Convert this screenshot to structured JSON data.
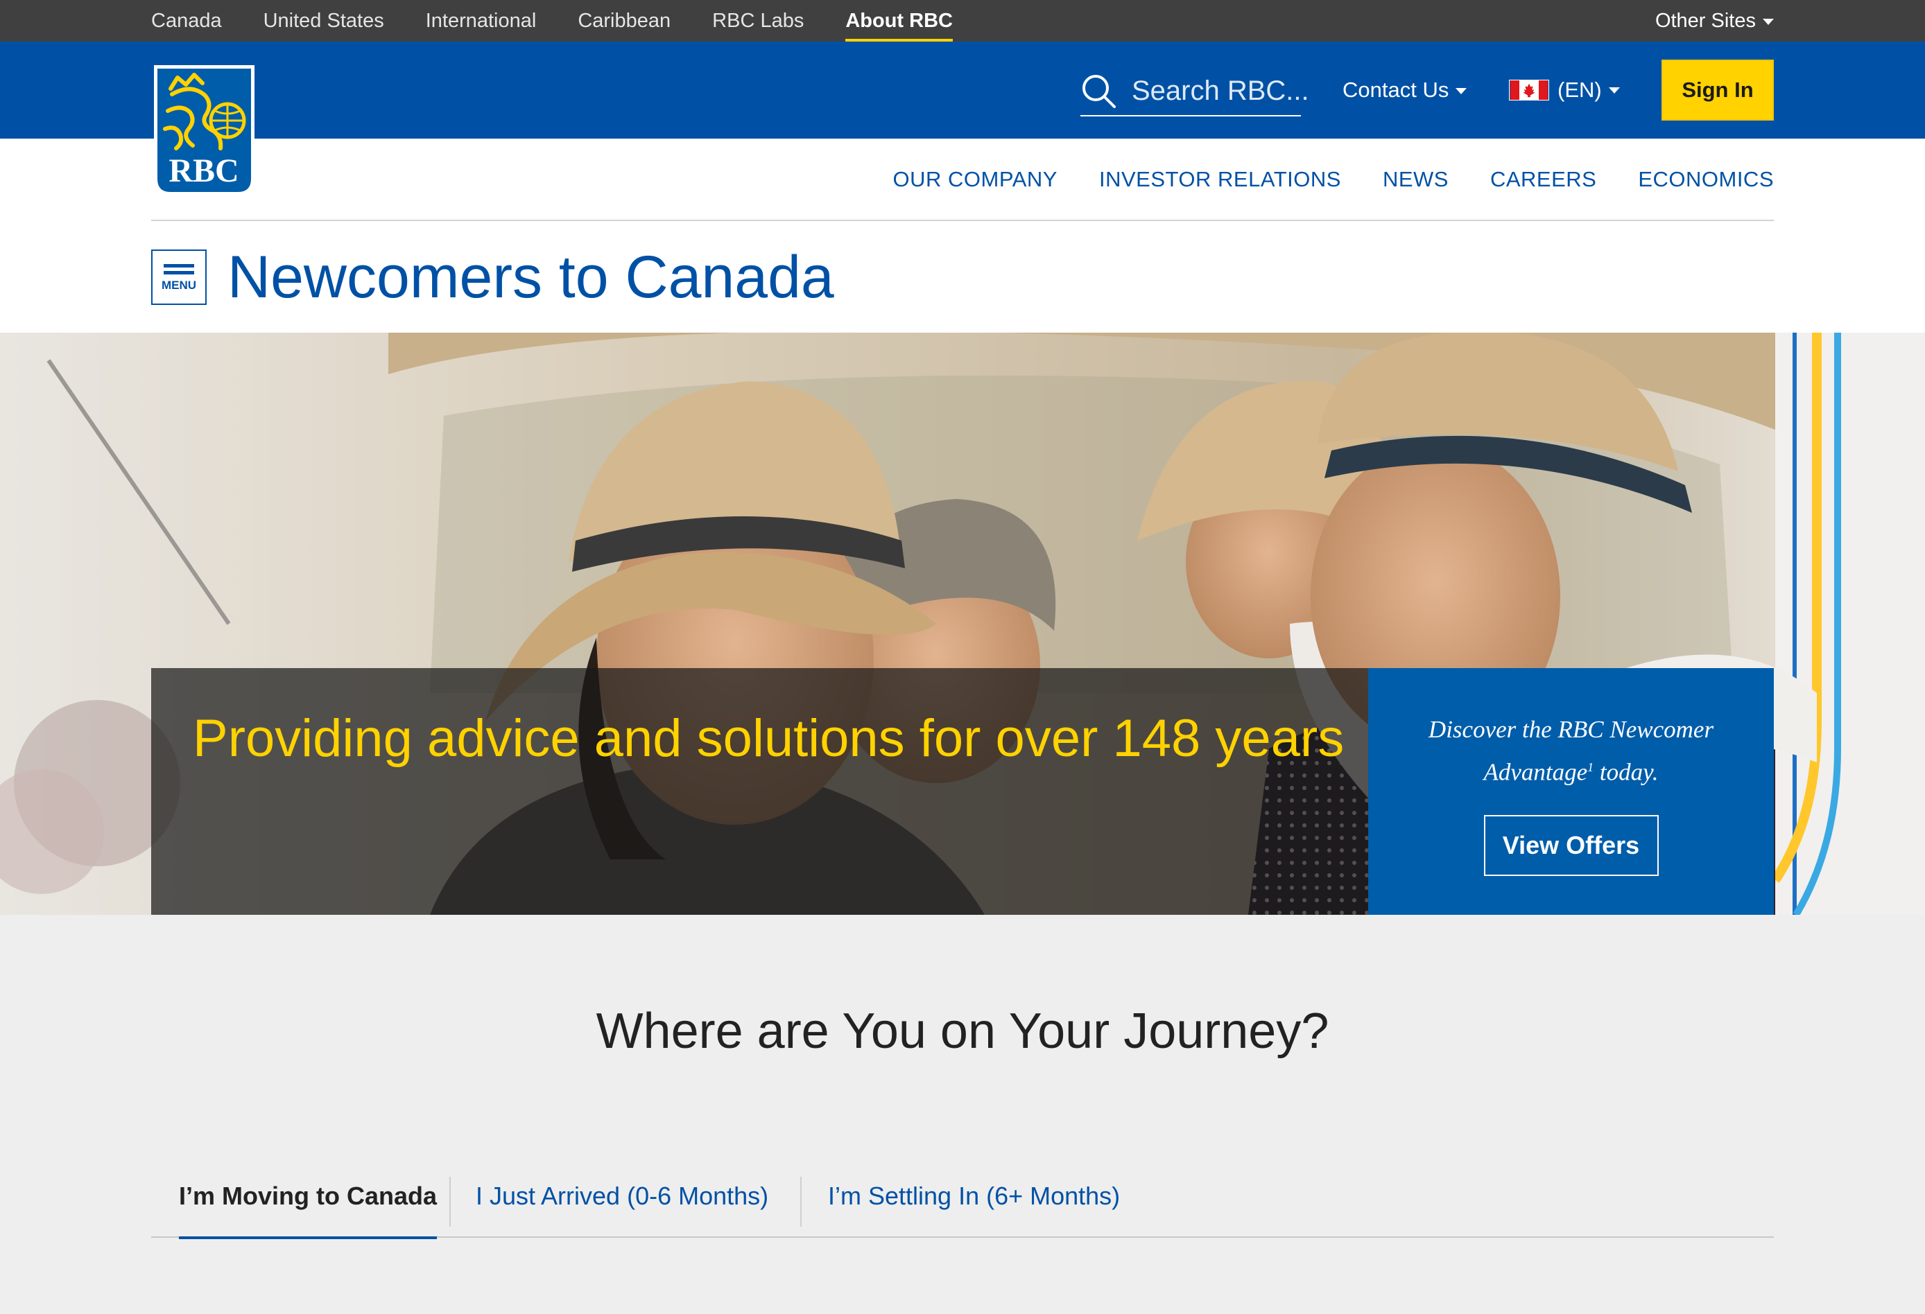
{
  "topbar": {
    "links": [
      {
        "label": "Canada"
      },
      {
        "label": "United States"
      },
      {
        "label": "International"
      },
      {
        "label": "Caribbean"
      },
      {
        "label": "RBC Labs"
      },
      {
        "label": "About RBC"
      }
    ],
    "active": "About RBC",
    "other_sites": "Other Sites"
  },
  "header": {
    "logo_text": "RBC",
    "search_placeholder": "Search RBC...",
    "contact": "Contact Us",
    "language": "(EN)",
    "sign_in": "Sign In"
  },
  "nav": {
    "items": [
      {
        "label": "OUR COMPANY"
      },
      {
        "label": "INVESTOR RELATIONS"
      },
      {
        "label": "NEWS"
      },
      {
        "label": "CAREERS"
      },
      {
        "label": "ECONOMICS"
      }
    ]
  },
  "page": {
    "menu_label": "MENU",
    "title": "Newcomers to Canada"
  },
  "hero": {
    "headline": "Providing advice and solutions for over 148 years",
    "offer_line1": "Discover the RBC Newcomer",
    "offer_line2a": "Advantage",
    "offer_sup": "1",
    "offer_line2b": " today.",
    "cta": "View Offers"
  },
  "journey": {
    "heading": "Where are You on Your Journey?",
    "tabs": [
      {
        "label": "I’m Moving to Canada"
      },
      {
        "label": "I Just Arrived (0-6 Months)"
      },
      {
        "label": "I’m Settling In (6+ Months)"
      }
    ]
  },
  "colors": {
    "rbc_blue": "#0051a5",
    "offer_blue": "#005daa",
    "rbc_yellow": "#ffd200",
    "topbar": "#404040",
    "section_gray": "#eeeeee"
  }
}
